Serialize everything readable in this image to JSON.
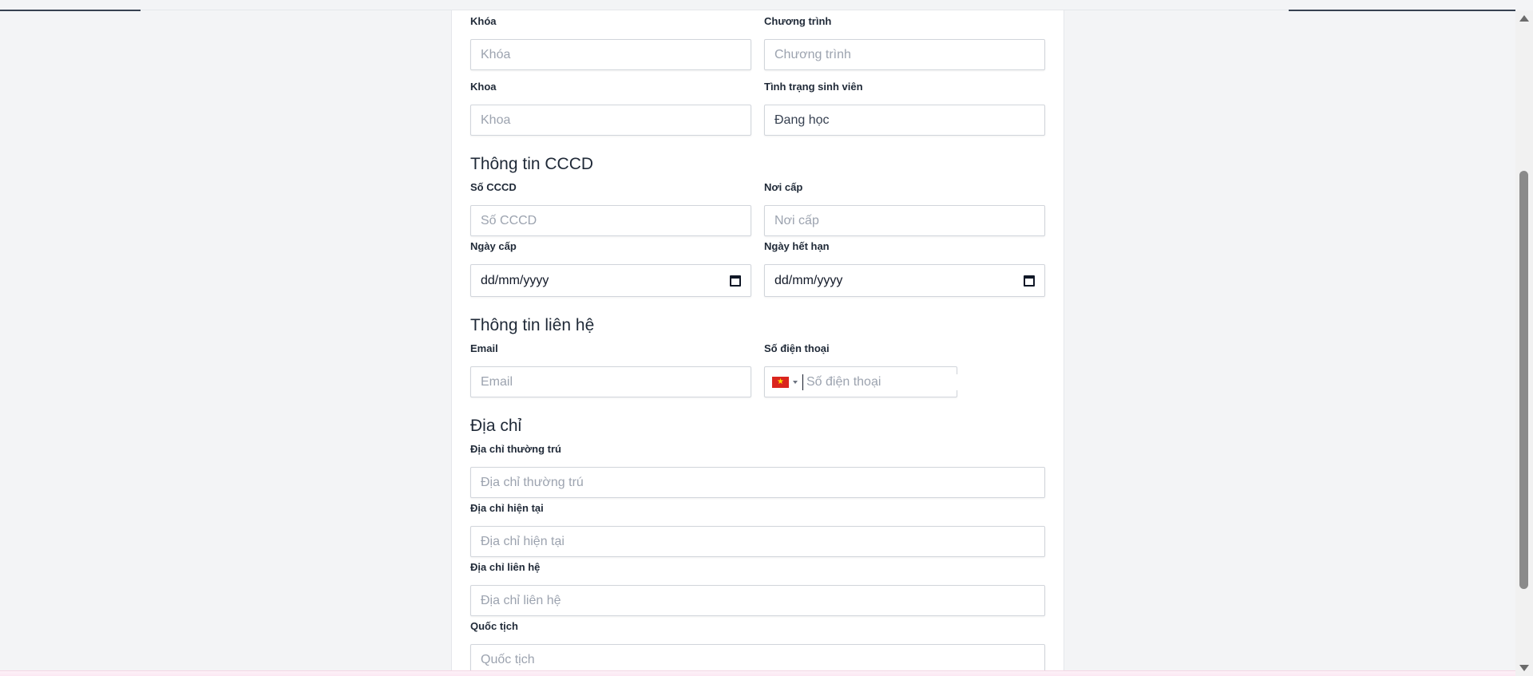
{
  "academic": {
    "khoa_course": {
      "label": "Khóa",
      "placeholder": "Khóa"
    },
    "program": {
      "label": "Chương trình",
      "placeholder": "Chương trình"
    },
    "faculty": {
      "label": "Khoa",
      "placeholder": "Khoa"
    },
    "status": {
      "label": "Tình trạng sinh viên",
      "value": "Đang học"
    }
  },
  "id_card": {
    "title": "Thông tin CCCD",
    "number": {
      "label": "Số CCCD",
      "placeholder": "Số CCCD"
    },
    "issue_place": {
      "label": "Nơi cấp",
      "placeholder": "Nơi cấp"
    },
    "issue_date": {
      "label": "Ngày cấp",
      "value": "dd/mm/yyyy"
    },
    "expiry_date": {
      "label": "Ngày hết hạn",
      "value": "dd/mm/yyyy"
    }
  },
  "contact": {
    "title": "Thông tin liên hệ",
    "email": {
      "label": "Email",
      "placeholder": "Email"
    },
    "phone": {
      "label": "Số điện thoại",
      "placeholder": "Số điện thoại",
      "country_flag": "vietnam-flag-icon",
      "flag_colors": [
        "#da251d",
        "#ffde00"
      ]
    }
  },
  "address": {
    "title": "Địa chỉ",
    "permanent": {
      "label": "Địa chỉ thường trú",
      "placeholder": "Địa chỉ thường trú"
    },
    "current": {
      "label": "Địa chỉ hiện tại",
      "placeholder": "Địa chỉ hiện tại"
    },
    "mailing": {
      "label": "Địa chỉ liên hệ",
      "placeholder": "Địa chỉ liên hệ"
    },
    "nationality": {
      "label": "Quốc tịch",
      "placeholder": "Quốc tịch"
    }
  },
  "colors": {
    "background": "#f3f4f6",
    "card": "#ffffff",
    "border": "#d1d5db",
    "placeholder": "#9ca3af"
  }
}
